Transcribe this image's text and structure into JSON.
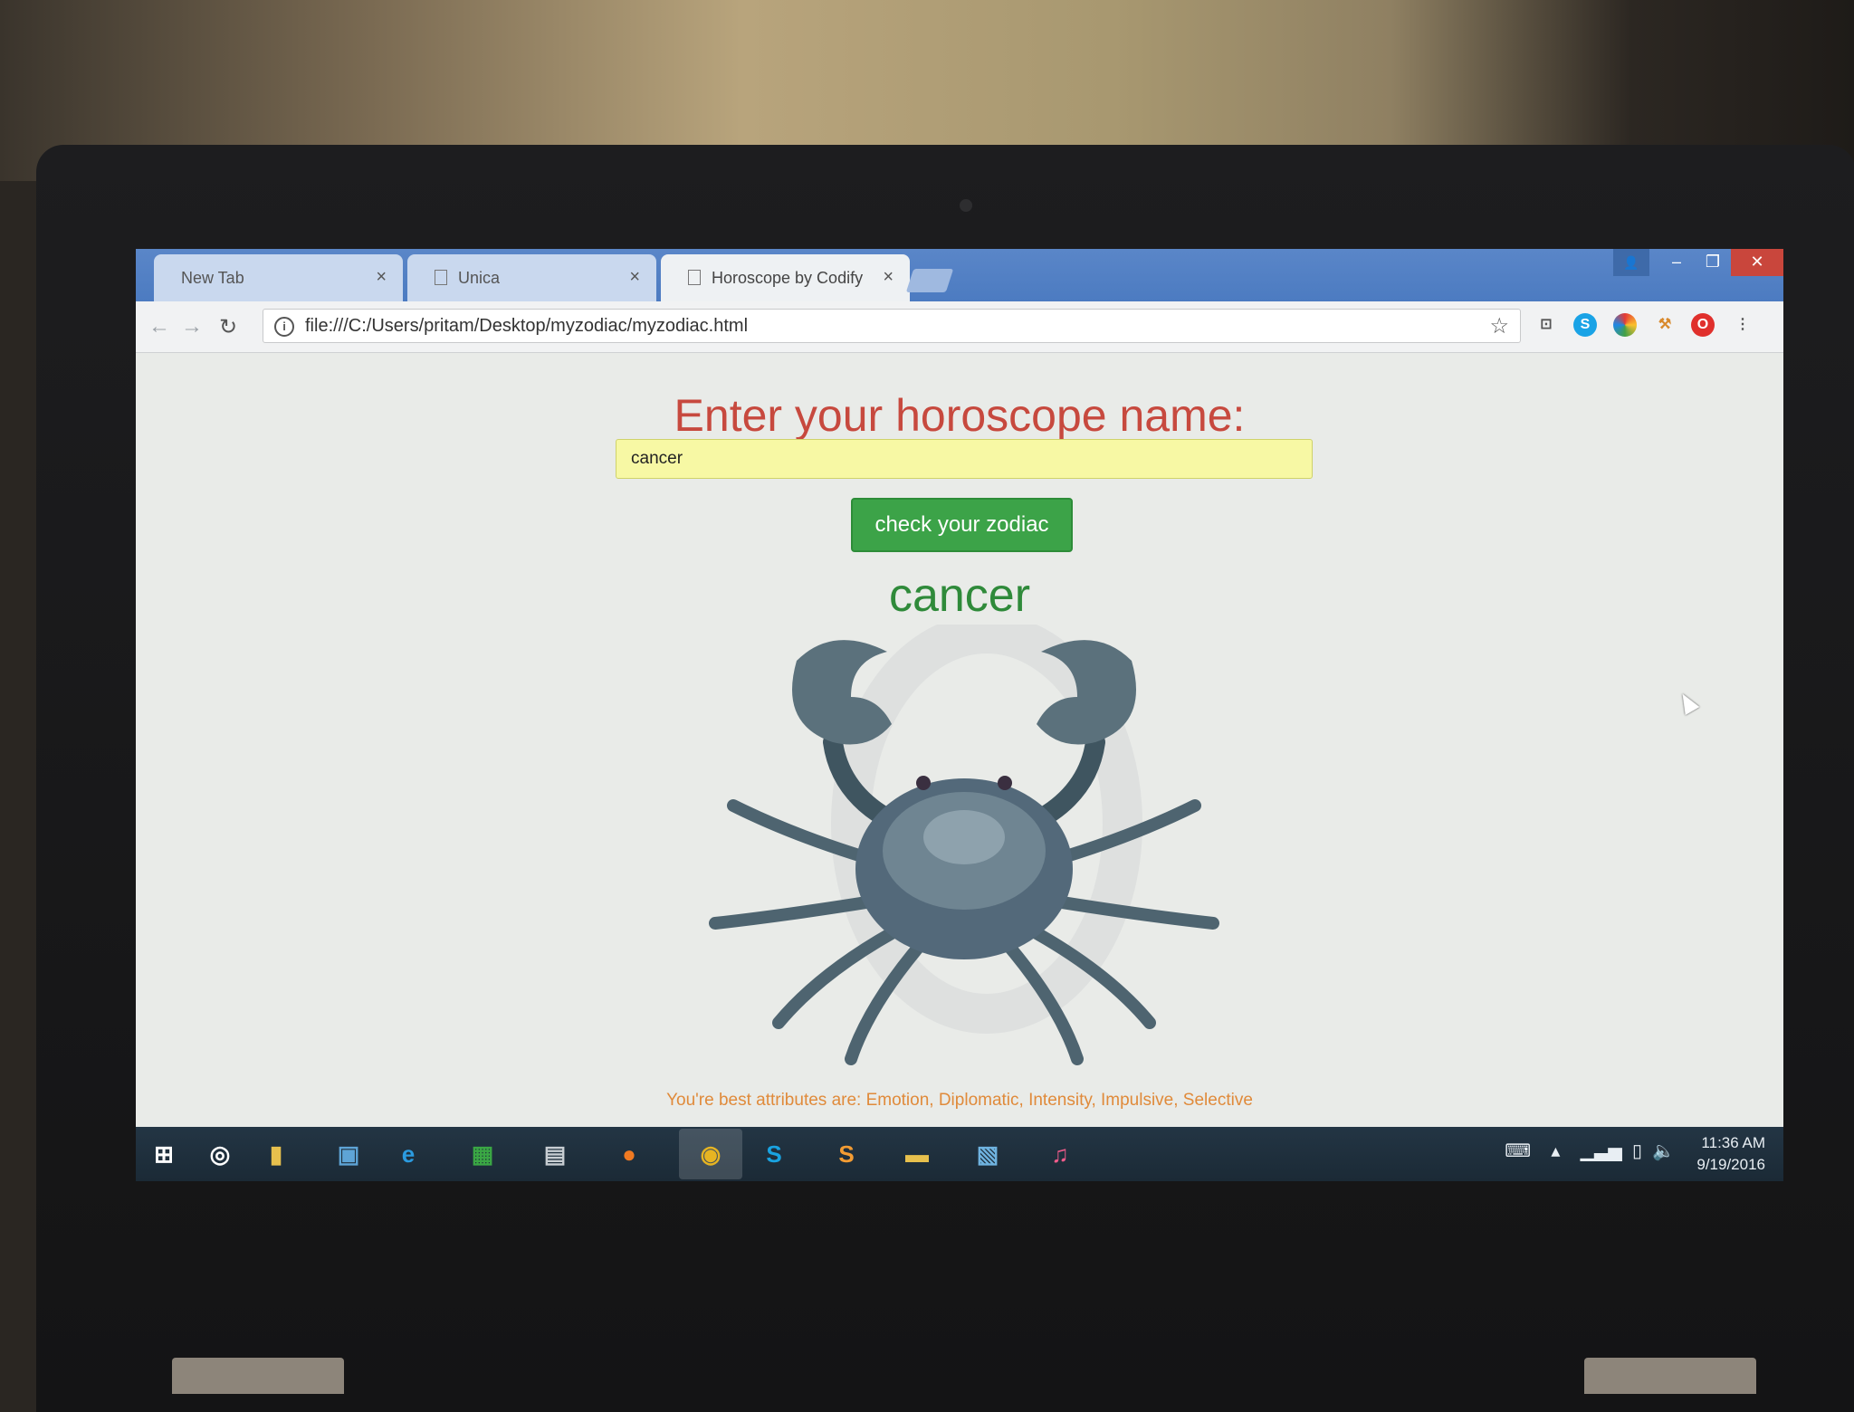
{
  "browser": {
    "tabs": [
      {
        "label": "New Tab",
        "active": false
      },
      {
        "label": "Unica",
        "active": false
      },
      {
        "label": "Horoscope by Codify",
        "active": true
      }
    ],
    "url": "file:///C:/Users/pritam/Desktop/myzodiac/myzodiac.html",
    "extensions": [
      "cast-icon",
      "skype-icon",
      "color-picker-icon",
      "hammer-icon",
      "opera-icon"
    ]
  },
  "page": {
    "heading": "Enter your horoscope name:",
    "input_value": "cancer",
    "button_label": "check your zodiac",
    "result_sign": "cancer",
    "attributes_text": "You're best attributes are: Emotion, Diplomatic, Intensity, Impulsive, Selective",
    "colors": {
      "heading": "#c7493e",
      "button": "#3ca348",
      "result": "#2f8a3a",
      "attributes": "#e08a3a",
      "input_bg": "#f7f8a4"
    }
  },
  "taskbar": {
    "apps": [
      "windows-start-icon",
      "cortana-icon",
      "file-explorer-icon",
      "remote-desktop-icon",
      "internet-explorer-icon",
      "store-icon",
      "calculator-icon",
      "firefox-icon",
      "chrome-icon",
      "skype-icon",
      "sublime-text-icon",
      "folder-icon",
      "photos-icon",
      "itunes-icon"
    ],
    "time": "11:36 AM",
    "date": "9/19/2016"
  }
}
